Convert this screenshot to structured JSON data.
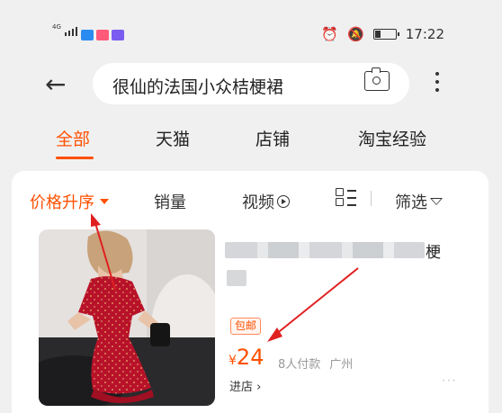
{
  "status_bar": {
    "network_label": "4G",
    "app_badges": [
      {
        "text": "",
        "color": "#2a8cf0"
      },
      {
        "text": "",
        "color": "#ff5a7a"
      },
      {
        "text": "",
        "color": "#7a5cf0"
      }
    ],
    "time": "17:22",
    "battery_level": 0.25
  },
  "search": {
    "back_icon": "back-arrow-icon",
    "query": "很仙的法国小众桔梗裙",
    "camera_icon": "camera-icon",
    "more_icon": "more-vertical-icon"
  },
  "tabs": [
    {
      "label": "全部",
      "active": true
    },
    {
      "label": "天猫",
      "active": false
    },
    {
      "label": "店铺",
      "active": false
    },
    {
      "label": "淘宝经验",
      "active": false
    }
  ],
  "sort_bar": {
    "price_sort": "价格升序",
    "sales": "销量",
    "video": "视频",
    "filter": "筛选"
  },
  "product": {
    "title_tail": "梗",
    "badge": "包邮",
    "currency": "¥",
    "price": "24",
    "buyers": "8人付款",
    "location": "广州",
    "shop_link": "进店 ›",
    "more": "···"
  },
  "colors": {
    "accent": "#ff5000",
    "annotation_arrow": "#e02020"
  }
}
